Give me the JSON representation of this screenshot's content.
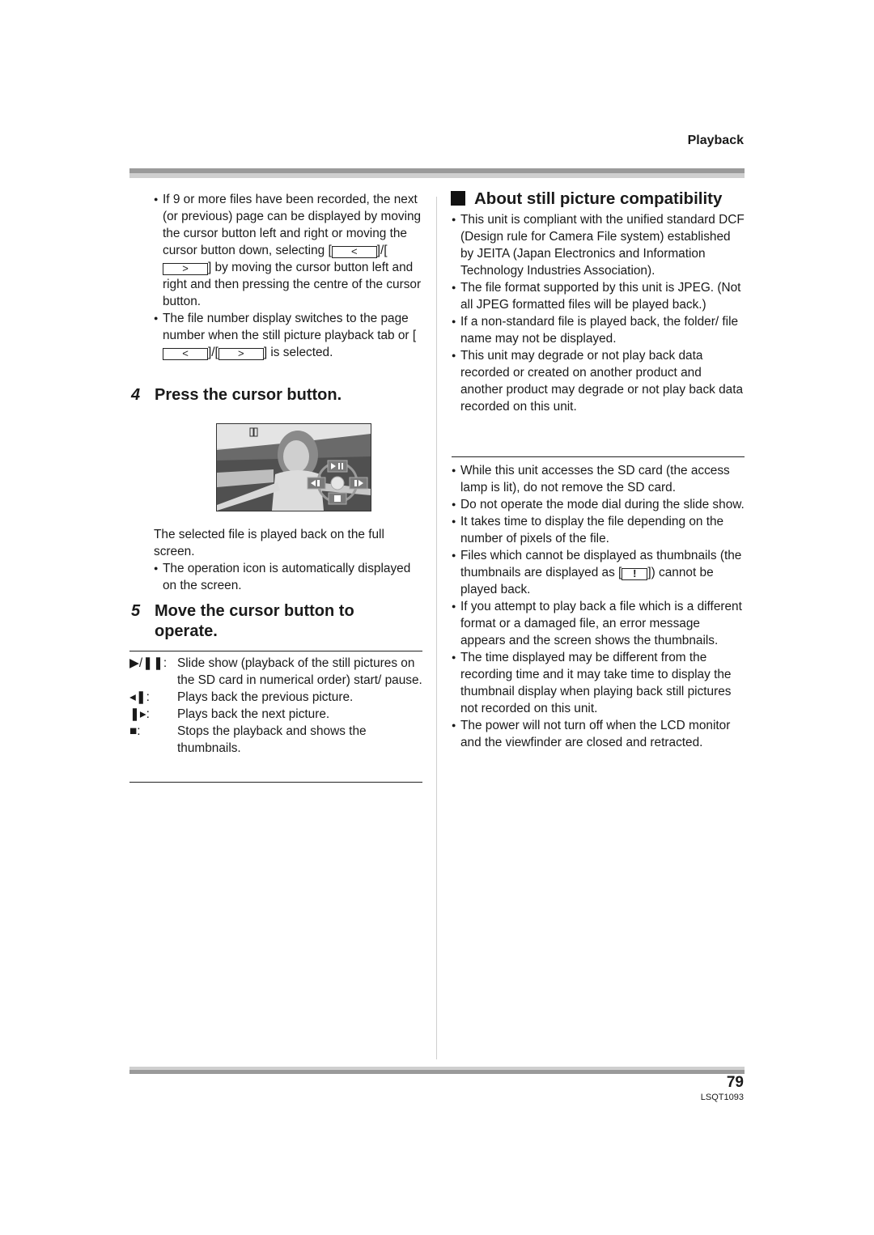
{
  "header": {
    "section": "Playback"
  },
  "left": {
    "bullets_top": [
      {
        "before": "If 9 or more files have been recorded, the next (or previous) page can be displayed by moving the cursor button left and right or moving the cursor button down, selecting [",
        "btn1": "<",
        "mid": "]/[",
        "btn2": ">",
        "after": "] by moving the cursor button left and right and then pressing the centre of the cursor button."
      },
      {
        "before": "The file number display switches to the page number when the still picture playback tab or [",
        "btn1": "<",
        "mid": "]/[",
        "btn2": ">",
        "after": "] is selected."
      }
    ],
    "step4": {
      "number": "4",
      "title": "Press the cursor button."
    },
    "screen": {
      "pause_icon": "pause-icon",
      "controls": {
        "top": "▶/❚❚",
        "left": "◀❚",
        "right": "❚▶",
        "bottom": "■"
      }
    },
    "after_screen": "The selected file is played back on the full screen.",
    "after_bullet": "The operation icon is automatically displayed on the screen.",
    "step5": {
      "number": "5",
      "title_line1": "Move the cursor button to",
      "title_line2": "operate."
    },
    "operations": [
      {
        "symbol": "▶/❚❚:",
        "icon": "play-pause-icon",
        "desc": "Slide show (playback of the still pictures on the SD card in numerical order) start/ pause."
      },
      {
        "symbol": "◂❚:",
        "icon": "previous-icon",
        "desc": "Plays back the previous picture."
      },
      {
        "symbol": "❚▸:",
        "icon": "next-icon",
        "desc": "Plays back the next picture."
      },
      {
        "symbol": "■:",
        "icon": "stop-icon",
        "desc": "Stops the playback and shows the thumbnails."
      }
    ]
  },
  "right": {
    "heading": "About still picture compatibility",
    "bullets_a": [
      "This unit is compliant with the unified standard DCF (Design rule for Camera File system) established by JEITA (Japan Electronics and Information Technology Industries Association).",
      "The file format supported by this unit is JPEG. (Not all JPEG formatted files will be played back.)",
      "If a non-standard file is played back, the folder/ file name may not be displayed.",
      "This unit may degrade or not play back data recorded or created on another product and another product may degrade or not play back data recorded on this unit."
    ],
    "bullets_b": [
      "While this unit accesses the SD card (the access lamp is lit), do not remove the SD card.",
      "Do not operate the mode dial during the slide show.",
      "It takes time to display the file depending on the number of pixels of the file."
    ],
    "thumb_bullet": {
      "before": "Files which cannot be displayed as thumbnails (the thumbnails are displayed as [",
      "icon": "!",
      "after": "]) cannot be played back."
    },
    "bullets_c": [
      "If you attempt to play back a file which is a different format or a damaged file, an error message appears and the screen shows the thumbnails.",
      "The time displayed may be different from the recording time and it may take time to display the thumbnail display when playing back still pictures not recorded on this unit.",
      "The power will not turn off when the LCD monitor and the viewfinder are closed and retracted."
    ]
  },
  "footer": {
    "page_number": "79",
    "doc_code": "LSQT1093"
  }
}
